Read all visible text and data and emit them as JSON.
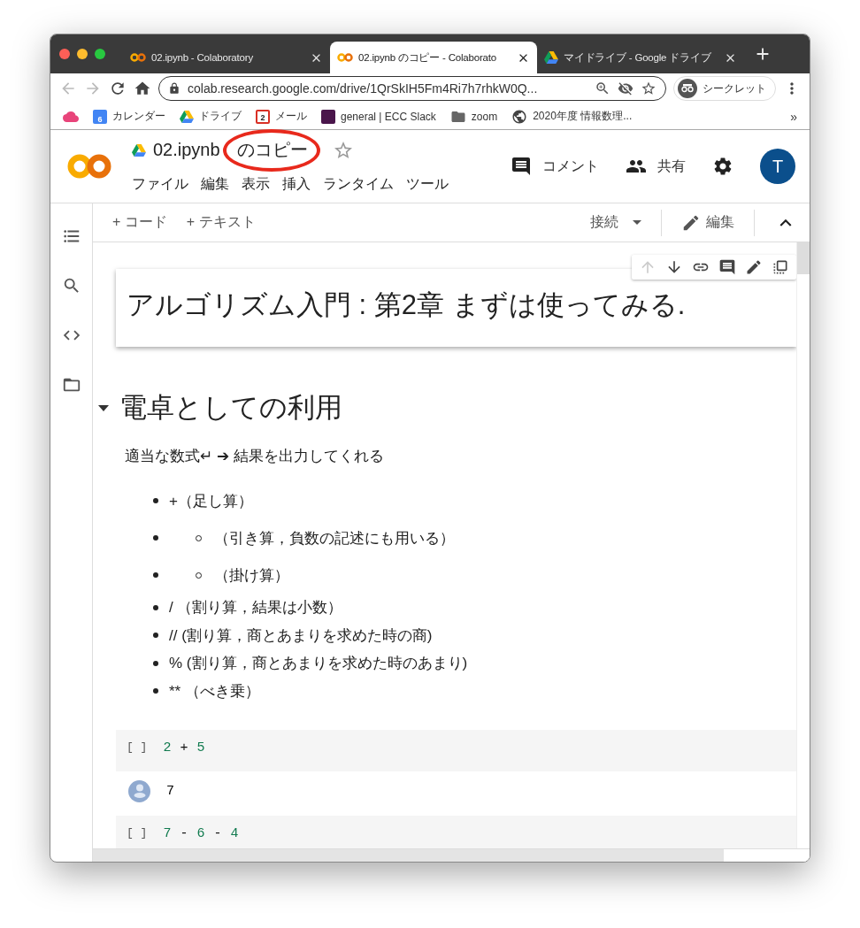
{
  "browser": {
    "tabs": [
      {
        "title": "02.ipynb - Colaboratory",
        "kind": "colab",
        "selected": false
      },
      {
        "title": "02.ipynb のコピー - Colaborato",
        "kind": "colab",
        "selected": true
      },
      {
        "title": "マイドライブ - Google ドライブ",
        "kind": "drive",
        "selected": false
      }
    ],
    "address": "colab.research.google.com/drive/1QrSkIH5Fm4Ri7h7rhkW0Q...",
    "profile": "シークレット",
    "bookmarks": [
      {
        "kind": "cloud"
      },
      {
        "kind": "calendar",
        "badge": "6",
        "label": "カレンダー"
      },
      {
        "kind": "drive",
        "label": "ドライブ"
      },
      {
        "kind": "mail",
        "badge": "2",
        "label": "メール"
      },
      {
        "kind": "chat",
        "label": "general | ECC Slack"
      },
      {
        "kind": "folder",
        "label": "zoom"
      },
      {
        "kind": "globe",
        "label": "2020年度 情報数理..."
      }
    ],
    "bookmarks_more": "»"
  },
  "colab": {
    "title": "02.ipynb のコピー",
    "starred": false,
    "menu": [
      "ファイル",
      "編集",
      "表示",
      "挿入",
      "ランタイム",
      "ツール"
    ],
    "comment": "コメント",
    "share": "共有",
    "avatar": "T"
  },
  "toolbar": {
    "add": [
      "+ コード",
      "+ テキスト"
    ],
    "connect": "接続",
    "edit": "編集"
  },
  "cell_toolbar": [
    {
      "kind": "up",
      "disabled": true
    },
    {
      "kind": "down",
      "disabled": false
    },
    {
      "kind": "link",
      "disabled": false
    },
    {
      "kind": "comment",
      "disabled": false
    },
    {
      "kind": "edit",
      "disabled": false
    },
    {
      "kind": "mirror",
      "disabled": false
    }
  ],
  "notebook": {
    "title": "アルゴリズム入門 : 第2章 まずは使ってみる.",
    "section": {
      "heading": "電卓としての利用",
      "expanded": true
    },
    "paragraph": "適当な数式↵ ➔ 結果を出力してくれる",
    "list": [
      {
        "text": "+（足し算）",
        "kind": "plain"
      },
      {
        "text": "（引き算，負数の記述にも用いる）",
        "kind": "nested"
      },
      {
        "text": "（掛け算）",
        "kind": "nested"
      },
      {
        "text": "/ （割り算，結果は小数）",
        "kind": "plain"
      },
      {
        "text": "// (割り算，商とあまりを求めた時の商)",
        "kind": "plain"
      },
      {
        "text": "% (割り算，商とあまりを求めた時のあまり)",
        "kind": "plain"
      },
      {
        "text": "** （べき乗）",
        "kind": "plain"
      }
    ],
    "code_cells": [
      {
        "prompt": "[ ]",
        "tokens": [
          {
            "text": "2",
            "kind": "number"
          },
          {
            "text": "+",
            "kind": "operator"
          },
          {
            "text": "5",
            "kind": "number"
          }
        ],
        "output": "7"
      },
      {
        "prompt": "[ ]",
        "tokens": [
          {
            "text": "7",
            "kind": "number"
          },
          {
            "text": "-",
            "kind": "operator"
          },
          {
            "text": "6",
            "kind": "number"
          },
          {
            "text": "-",
            "kind": "operator"
          },
          {
            "text": "4",
            "kind": "number"
          }
        ]
      }
    ]
  }
}
